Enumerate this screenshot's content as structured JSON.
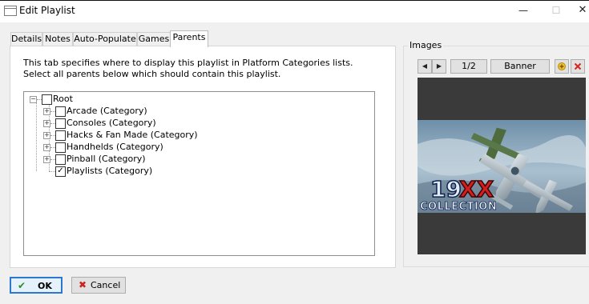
{
  "window": {
    "title": "Edit Playlist",
    "controls": [
      "minimize-icon",
      "maximize-icon",
      "close-icon"
    ]
  },
  "tabs": [
    {
      "label": "Details",
      "active": false
    },
    {
      "label": "Notes",
      "active": false
    },
    {
      "label": "Auto-Populate",
      "active": false
    },
    {
      "label": "Games",
      "active": false
    },
    {
      "label": "Parents",
      "active": true
    }
  ],
  "parents": {
    "description": "This tab specifies where to display this playlist in Platform Categories lists. Select all parents below which should contain this playlist.",
    "tree": {
      "root": {
        "label": "Root",
        "checked": false,
        "expanded": true
      },
      "children": [
        {
          "label": "Arcade (Category)",
          "checked": false,
          "expandable": true
        },
        {
          "label": "Consoles (Category)",
          "checked": false,
          "expandable": true
        },
        {
          "label": "Hacks & Fan Made (Category)",
          "checked": false,
          "expandable": true
        },
        {
          "label": "Handhelds (Category)",
          "checked": false,
          "expandable": true
        },
        {
          "label": "Pinball (Category)",
          "checked": false,
          "expandable": true
        },
        {
          "label": "Playlists (Category)",
          "checked": true,
          "expandable": false
        }
      ]
    }
  },
  "images": {
    "group_label": "Images",
    "counter": "1/2",
    "image_type": "Banner",
    "banner_text": {
      "number": "19",
      "letters": "XX",
      "subtitle": "COLLECTION"
    },
    "icons": [
      "arrow-left-icon",
      "arrow-right-icon",
      "add-image-icon",
      "delete-image-icon"
    ]
  },
  "buttons": {
    "ok_label": "OK",
    "cancel_label": "Cancel"
  },
  "colors": {
    "ok_border": "#2a77d4",
    "delete_icon": "#d9241b",
    "ok_icon": "#2e8b2e",
    "cancel_icon": "#cc2222"
  }
}
